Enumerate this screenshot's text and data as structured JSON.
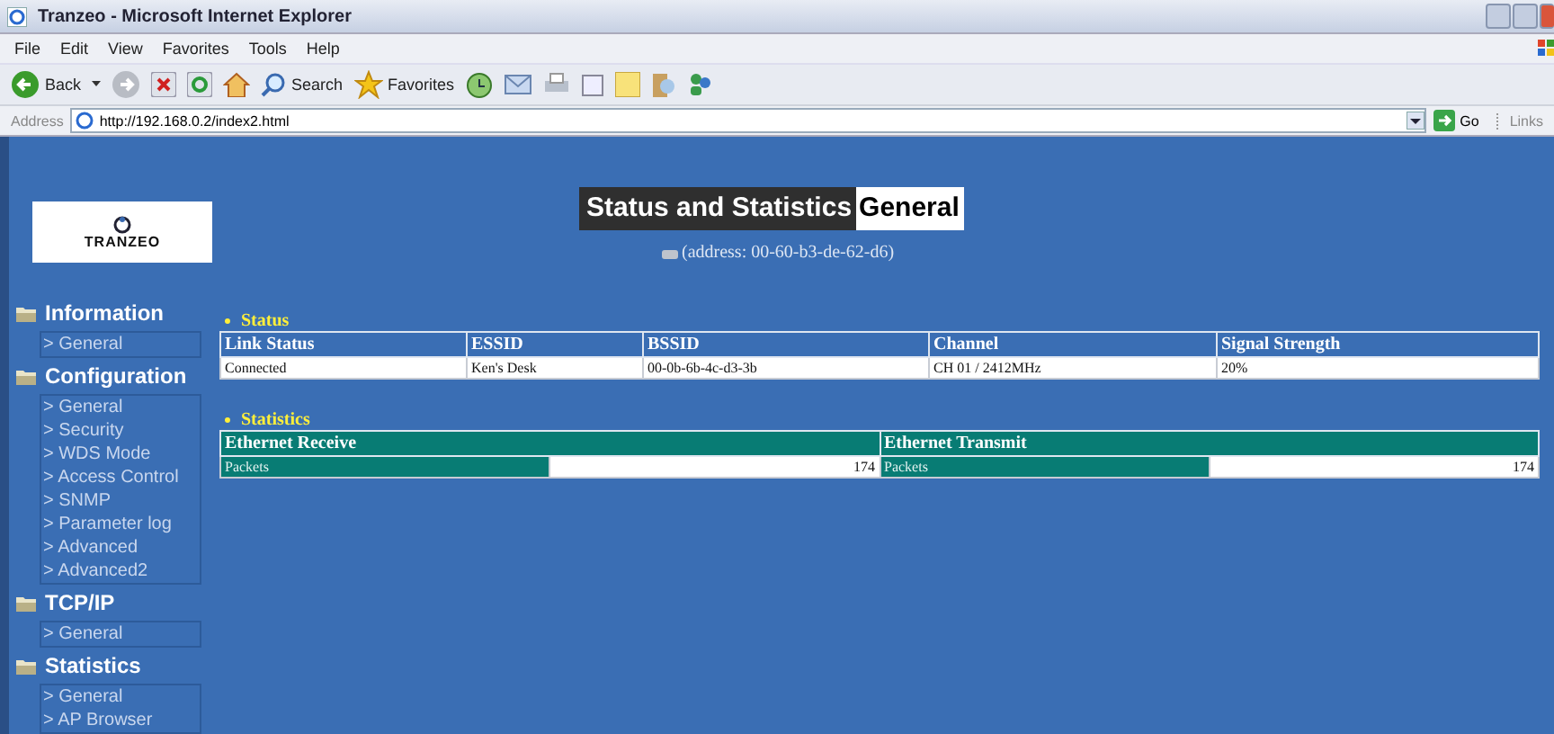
{
  "window": {
    "title": "Tranzeo  - Microsoft Internet Explorer"
  },
  "menu": [
    "File",
    "Edit",
    "View",
    "Favorites",
    "Tools",
    "Help"
  ],
  "toolbar": {
    "back": "Back",
    "search": "Search",
    "favorites": "Favorites"
  },
  "address_bar": {
    "label": "Address",
    "url": "http://192.168.0.2/index2.html",
    "go": "Go",
    "links": "Links"
  },
  "page": {
    "logo_text": "TRANZEO",
    "title": "Status and Statistics",
    "subtitle": "General",
    "address_line": "(address: 00-60-b3-de-62-d6)"
  },
  "sidebar": [
    {
      "heading": "Information",
      "items": [
        "> General"
      ]
    },
    {
      "heading": "Configuration",
      "items": [
        "> General",
        "> Security",
        "> WDS Mode",
        "> Access Control",
        "> SNMP",
        "> Parameter log",
        "> Advanced",
        "> Advanced2"
      ]
    },
    {
      "heading": "TCP/IP",
      "items": [
        "> General"
      ]
    },
    {
      "heading": "Statistics",
      "items": [
        "> General",
        "> AP Browser"
      ]
    }
  ],
  "status": {
    "heading": "Status",
    "columns": [
      "Link Status",
      "ESSID",
      "BSSID",
      "Channel",
      "Signal Strength"
    ],
    "row": [
      "Connected",
      "Ken's Desk",
      "00-0b-6b-4c-d3-3b",
      "CH 01 / 2412MHz",
      "20%"
    ]
  },
  "statistics": {
    "heading": "Statistics",
    "columns": [
      "Ethernet Receive",
      "Ethernet Transmit"
    ],
    "row": [
      {
        "label": "Packets",
        "value": "174"
      },
      {
        "label": "Packets",
        "value": "174"
      }
    ]
  }
}
